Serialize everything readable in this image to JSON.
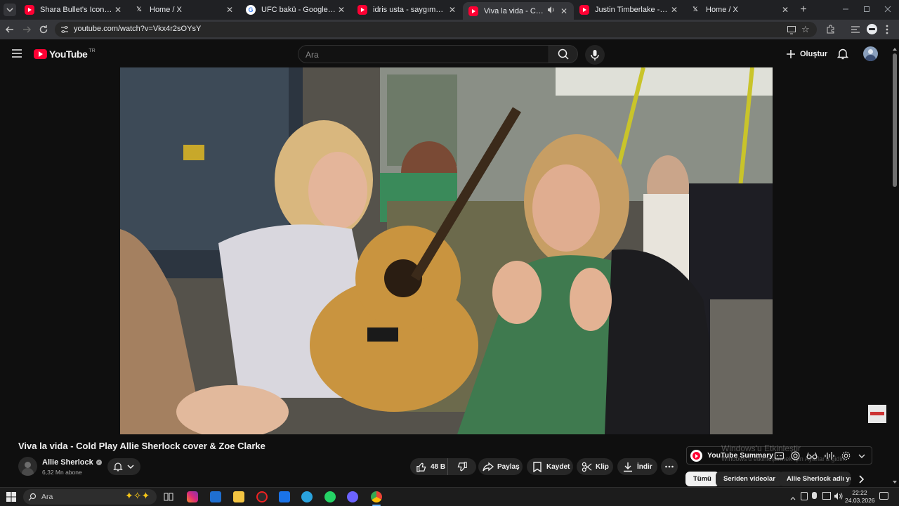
{
  "browser": {
    "tabs": [
      {
        "title": "Shara Bullet's Iconic Combo",
        "favicon": "youtube",
        "active": false
      },
      {
        "title": "Home / X",
        "favicon": "x",
        "active": false
      },
      {
        "title": "UFC bakü - Google'da Ara",
        "favicon": "google",
        "active": false
      },
      {
        "title": "idris usta - saygımdan - YouTube",
        "favicon": "youtube",
        "active": false
      },
      {
        "title": "Viva la vida - Cold Play Allie Sherlock",
        "favicon": "youtube",
        "active": true
      },
      {
        "title": "Justin Timberlake - SexyBack (Official Video)",
        "favicon": "youtube",
        "active": false
      },
      {
        "title": "Home / X",
        "favicon": "x",
        "active": false
      }
    ],
    "url": "youtube.com/watch?v=Vkx4r2sOYsY"
  },
  "youtube": {
    "logo_text": "YouTube",
    "region": "TR",
    "search_placeholder": "Ara",
    "create_label": "Oluştur"
  },
  "video": {
    "title": "Viva la vida - Cold Play Allie Sherlock cover & Zoe Clarke",
    "channel": "Allie Sherlock",
    "subscribers": "6,32 Mn abone",
    "likes": "48 B",
    "share_label": "Paylaş",
    "save_label": "Kaydet",
    "clip_label": "Klip",
    "download_label": "İndir"
  },
  "extension": {
    "name": "YouTube Summary"
  },
  "chips": [
    {
      "label": "Tümü",
      "active": true
    },
    {
      "label": "Seriden videolar",
      "active": false
    },
    {
      "label": "Allie Sherlock adlı yük",
      "active": false
    }
  ],
  "windows": {
    "watermark_title": "Windows'u Etkinleştir",
    "watermark_sub": "Windows'u etkinleştirmek için Ayarlar'a gidin.",
    "search_placeholder": "Ara",
    "time": "22:22",
    "date": "24.03.2026"
  },
  "colors": {
    "youtube_red": "#ff0033",
    "background": "#0f0f0f",
    "pill": "#272727"
  }
}
